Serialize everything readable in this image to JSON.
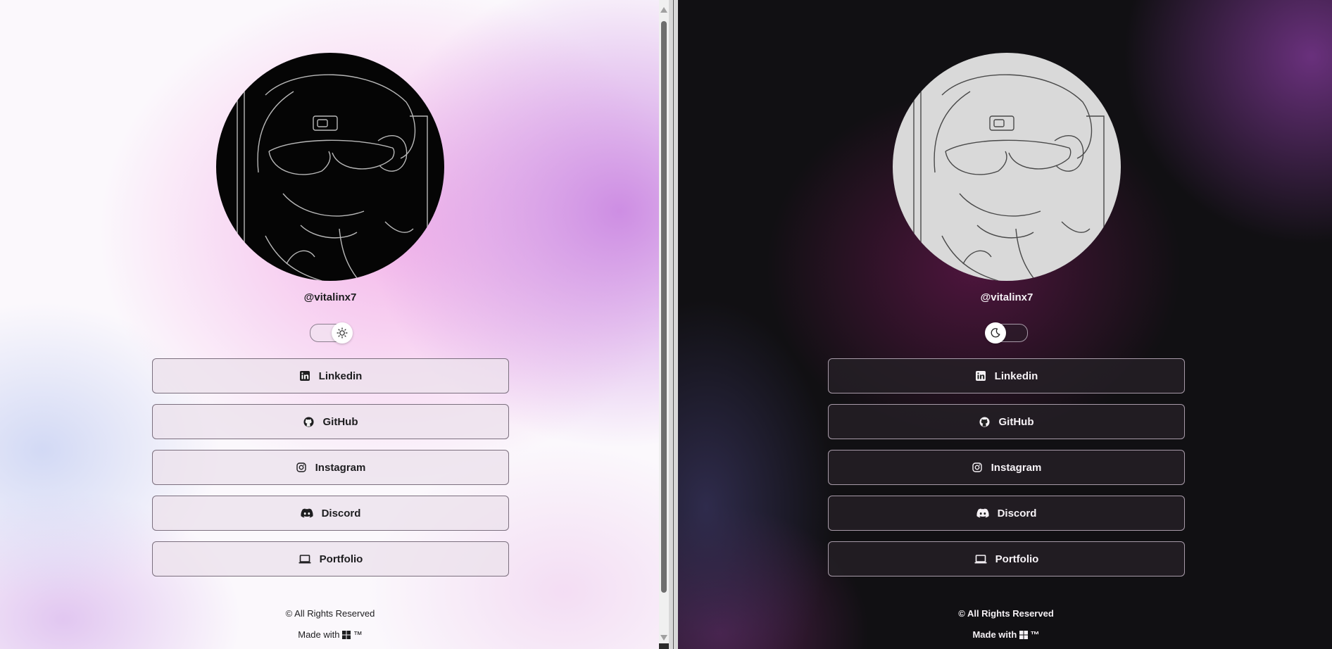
{
  "profile": {
    "username": "@vitalinx7"
  },
  "themes": {
    "light": {
      "toggle_state": "light",
      "icon": "sun-icon"
    },
    "dark": {
      "toggle_state": "dark",
      "icon": "moon-icon"
    }
  },
  "links": [
    {
      "label": "Linkedin",
      "icon": "linkedin-icon"
    },
    {
      "label": "GitHub",
      "icon": "github-icon"
    },
    {
      "label": "Instagram",
      "icon": "instagram-icon"
    },
    {
      "label": "Discord",
      "icon": "discord-icon"
    },
    {
      "label": "Portfolio",
      "icon": "laptop-icon"
    }
  ],
  "footer": {
    "rights": "© All Rights Reserved",
    "made_with": "Made with",
    "trademark": "™"
  },
  "colors": {
    "light_accent": "#cb89e2",
    "dark_accent": "#6e3282"
  }
}
